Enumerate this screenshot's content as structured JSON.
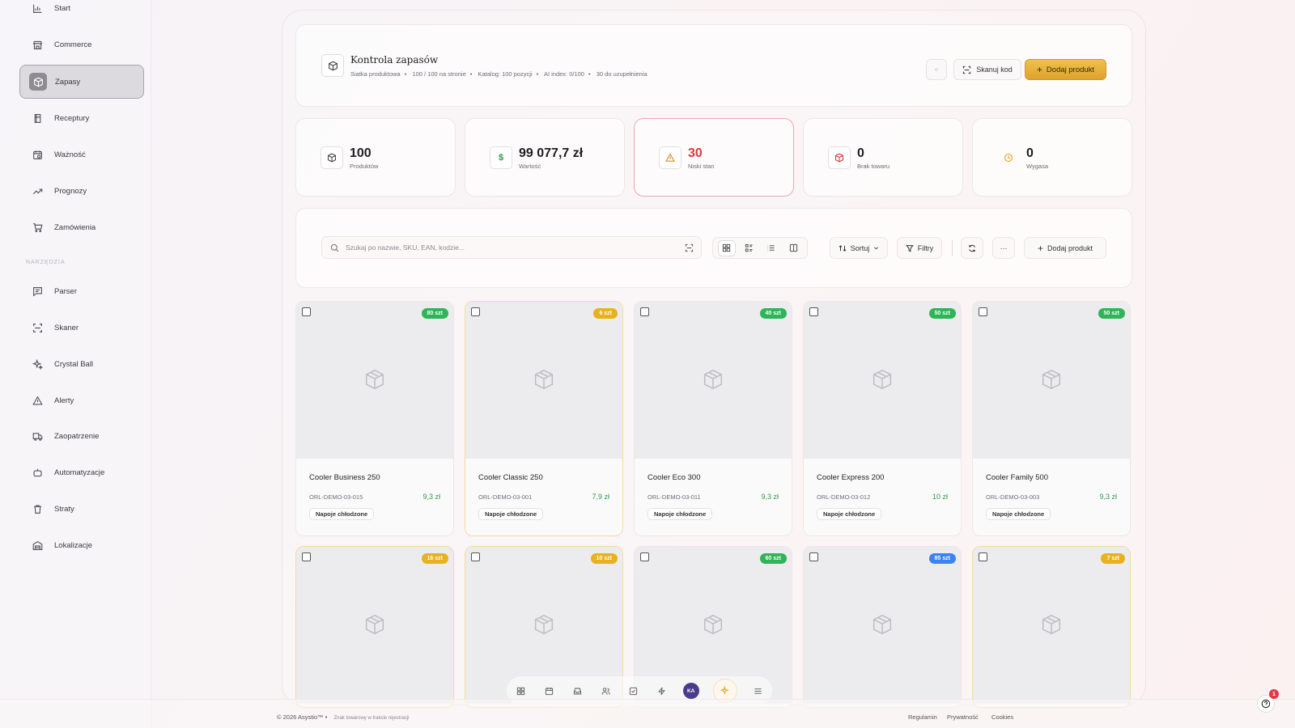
{
  "colors": {
    "accent_gold": "#e8b43b",
    "badge_green": "#2fb457",
    "badge_yellow": "#e7b21c",
    "badge_blue": "#3b82f6",
    "danger": "#d83a3a",
    "price_green": "#2c9a4a"
  },
  "sidebar": {
    "items": [
      {
        "label": "Start",
        "icon": "bar-chart-icon"
      },
      {
        "label": "Commerce",
        "icon": "store-icon"
      },
      {
        "label": "Zapasy",
        "icon": "box-icon",
        "active": true
      },
      {
        "label": "Receptury",
        "icon": "recipe-icon"
      },
      {
        "label": "Ważność",
        "icon": "calendar-clock-icon"
      },
      {
        "label": "Prognozy",
        "icon": "trending-up-icon"
      },
      {
        "label": "Zamówienia",
        "icon": "cart-icon"
      }
    ],
    "section_label": "NARZĘDZIA",
    "tools": [
      {
        "label": "Parser",
        "icon": "message-icon"
      },
      {
        "label": "Skaner",
        "icon": "scan-icon"
      },
      {
        "label": "Crystal Ball",
        "icon": "sparkles-icon"
      },
      {
        "label": "Alerty",
        "icon": "warning-icon"
      },
      {
        "label": "Zaopatrzenie",
        "icon": "truck-icon"
      },
      {
        "label": "Automatyzacje",
        "icon": "bot-icon"
      },
      {
        "label": "Straty",
        "icon": "trash-icon"
      },
      {
        "label": "Lokalizacje",
        "icon": "warehouse-icon"
      }
    ]
  },
  "header": {
    "title": "Kontrola zapasów",
    "meta": [
      "Siatka produktowa",
      "100 / 100 na stronie",
      "Katalog: 100 pozycji",
      "AI index: 0/100",
      "30 do uzupełnienia"
    ],
    "small_button": "○",
    "scan_label": "Skanuj kod",
    "add_label": "Dodaj produkt"
  },
  "stats": [
    {
      "value": "100",
      "label": "Produktów",
      "icon": "box-icon"
    },
    {
      "value": "99 077,7 zł",
      "label": "Wartość",
      "icon": "dollar-icon"
    },
    {
      "value": "30",
      "label": "Niski stan",
      "icon": "warning-icon",
      "highlight": true
    },
    {
      "value": "0",
      "label": "Brak towaru",
      "icon": "box-x-icon"
    },
    {
      "value": "0",
      "label": "Wygasa",
      "icon": "clock-icon"
    }
  ],
  "toolbar": {
    "search_placeholder": "Szukaj po nazwie, SKU, EAN, kodzie...",
    "sort_label": "Sortuj",
    "filters_label": "Filtry",
    "more_label": "···",
    "add_label": "Dodaj produkt"
  },
  "products": [
    {
      "name": "Cooler Business 250",
      "sku": "ORL-DEMO-03-015",
      "price": "9,3 zł",
      "category": "Napoje chłodzone",
      "stock": "80 szt",
      "status": "ok"
    },
    {
      "name": "Cooler Classic 250",
      "sku": "ORL-DEMO-03-001",
      "price": "7,9 zł",
      "category": "Napoje chłodzone",
      "stock": "6 szt",
      "status": "low"
    },
    {
      "name": "Cooler Eco 300",
      "sku": "ORL-DEMO-03-011",
      "price": "9,3 zł",
      "category": "Napoje chłodzone",
      "stock": "40 szt",
      "status": "ok"
    },
    {
      "name": "Cooler Express 200",
      "sku": "ORL-DEMO-03-012",
      "price": "10 zł",
      "category": "Napoje chłodzone",
      "stock": "50 szt",
      "status": "ok"
    },
    {
      "name": "Cooler Family 500",
      "sku": "ORL-DEMO-03-003",
      "price": "9,3 zł",
      "category": "Napoje chłodzone",
      "stock": "50 szt",
      "status": "ok"
    },
    {
      "stock": "16 szt",
      "status": "low"
    },
    {
      "stock": "10 szt",
      "status": "low"
    },
    {
      "stock": "60 szt",
      "status": "ok"
    },
    {
      "stock": "85 szt",
      "status": "high"
    },
    {
      "stock": "7 szt",
      "status": "low"
    }
  ],
  "dock": {
    "avatar_initials": "KA"
  },
  "footer": {
    "copyright": "© 2026 Asystio™ •",
    "trademark_note": "Znak towarowy w trakcie rejestracji",
    "links": [
      "Regulamin",
      "Prywatność",
      "Cookies"
    ]
  },
  "help": {
    "notification_count": "1"
  }
}
